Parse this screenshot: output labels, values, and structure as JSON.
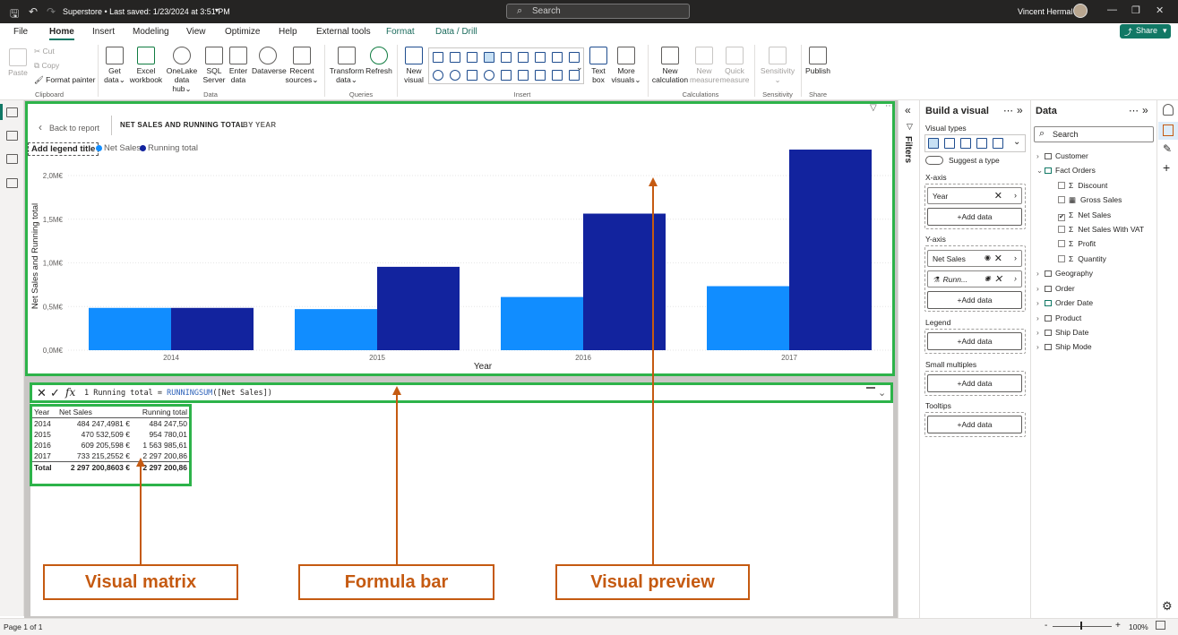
{
  "titlebar": {
    "doc_title": "Superstore • Last saved: 1/23/2024 at 3:51 PM",
    "search_placeholder": "Search",
    "user_name": "Vincent Hermal"
  },
  "menu": [
    "File",
    "Home",
    "Insert",
    "Modeling",
    "View",
    "Optimize",
    "Help",
    "External tools",
    "Format",
    "Data / Drill"
  ],
  "share_label": "Share",
  "ribbon": {
    "clipboard": {
      "paste": "Paste",
      "cut": "Cut",
      "copy": "Copy",
      "format_painter": "Format painter",
      "label": "Clipboard"
    },
    "data": {
      "get_data": "Get data",
      "excel": "Excel workbook",
      "onelake": "OneLake data hub",
      "sql": "SQL Server",
      "enter": "Enter data",
      "dataverse": "Dataverse",
      "recent": "Recent sources",
      "label": "Data"
    },
    "queries": {
      "transform": "Transform data",
      "refresh": "Refresh",
      "label": "Queries"
    },
    "insert": {
      "new_visual": "New visual",
      "text_box": "Text box",
      "more_visuals": "More visuals",
      "label": "Insert"
    },
    "calculations": {
      "new_calc": "New calculation",
      "new_measure": "New measure",
      "quick_measure": "Quick measure",
      "label": "Calculations"
    },
    "sensitivity": {
      "btn": "Sensitivity",
      "label": "Sensitivity"
    },
    "share": {
      "publish": "Publish",
      "label": "Share"
    }
  },
  "preview": {
    "back": "Back to report",
    "title": "NET SALES AND RUNNING TOTAL",
    "subtitle": "BY YEAR",
    "legend_title": "Add legend title"
  },
  "chart_data": {
    "type": "bar",
    "categories": [
      "2014",
      "2015",
      "2016",
      "2017"
    ],
    "series": [
      {
        "name": "Net Sales",
        "color": "#118dff",
        "values": [
          484247.4981,
          470532.509,
          609205.598,
          733215.2552
        ]
      },
      {
        "name": "Running total",
        "color": "#12239e",
        "values": [
          484247.5,
          954780.01,
          1563985.61,
          2297200.86
        ]
      }
    ],
    "y_ticks": [
      "0,0M€",
      "0,5M€",
      "1,0M€",
      "1,5M€",
      "2,0M€"
    ],
    "ylim": [
      0,
      2000000
    ],
    "xlabel": "Year",
    "ylabel": "Net Sales and Running total"
  },
  "formula": {
    "line_no": "1",
    "pre": " Running total = ",
    "fn": "RUNNINGSUM",
    "post": "([Net Sales])"
  },
  "matrix": {
    "headers": [
      "Year",
      "Net Sales",
      "Running total"
    ],
    "rows": [
      [
        "2014",
        "484 247,4981 €",
        "484 247,50"
      ],
      [
        "2015",
        "470 532,509 €",
        "954 780,01"
      ],
      [
        "2016",
        "609 205,598 €",
        "1 563 985,61"
      ],
      [
        "2017",
        "733 215,2552 €",
        "2 297 200,86"
      ]
    ],
    "total": [
      "Total",
      "2 297 200,8603 €",
      "2 297 200,86"
    ]
  },
  "callouts": {
    "matrix": "Visual matrix",
    "formula": "Formula bar",
    "preview": "Visual preview"
  },
  "callout_color": "#c55a11",
  "highlight_color": "#2db34a",
  "filters_label": "Filters",
  "build": {
    "title": "Build a visual",
    "visual_types": "Visual types",
    "suggest": "Suggest a type",
    "xaxis": "X-axis",
    "x_field": "Year",
    "yaxis": "Y-axis",
    "y_field1": "Net Sales",
    "y_field2": "Runn...",
    "legend": "Legend",
    "small_multiples": "Small multiples",
    "tooltips": "Tooltips",
    "add_data": "+Add data"
  },
  "data_pane": {
    "title": "Data",
    "search_placeholder": "Search",
    "tables": [
      "Customer",
      "Fact Orders",
      "Geography",
      "Order",
      "Order Date",
      "Product",
      "Ship Date",
      "Ship Mode"
    ],
    "fields": [
      "Discount",
      "Gross Sales",
      "Net Sales",
      "Net Sales With VAT",
      "Profit",
      "Quantity"
    ]
  },
  "status": {
    "page": "Page 1 of 1",
    "zoom": "100%"
  }
}
